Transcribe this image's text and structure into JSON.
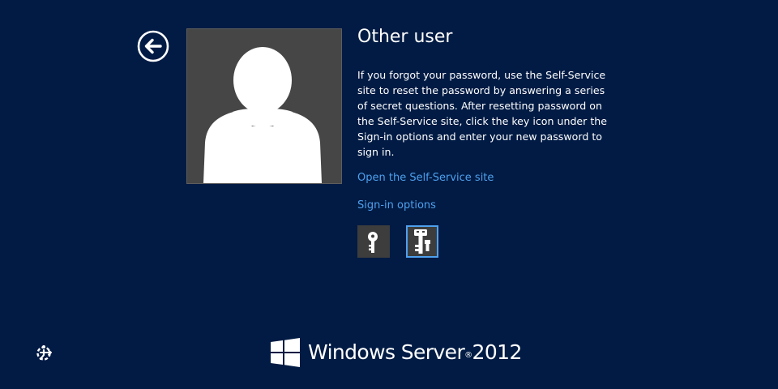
{
  "screen": {
    "title": "Other user",
    "message": "If you forgot your password, use the Self-Service site to reset the password by answering a series of secret questions. After resetting password on the Self-Service site, click the key icon under the Sign-in options and enter your new password to sign in.",
    "links": {
      "self_service": "Open the Self-Service site",
      "sign_in_options": "Sign-in options"
    }
  },
  "icons": {
    "back": "back-arrow-icon",
    "avatar": "user-silhouette-icon",
    "password_tile": "key-icon",
    "self_service_tile": "self-service-key-icon",
    "ease_of_access": "ease-of-access-icon",
    "brand_logo": "windows-logo-icon"
  },
  "brand": {
    "name": "Windows Server",
    "version": "2012"
  },
  "colors": {
    "background": "#011b44",
    "link": "#4ea0ee",
    "tile": "#3d3d3d",
    "avatar_bg": "#464646",
    "selected_border": "#4ea0ee"
  }
}
